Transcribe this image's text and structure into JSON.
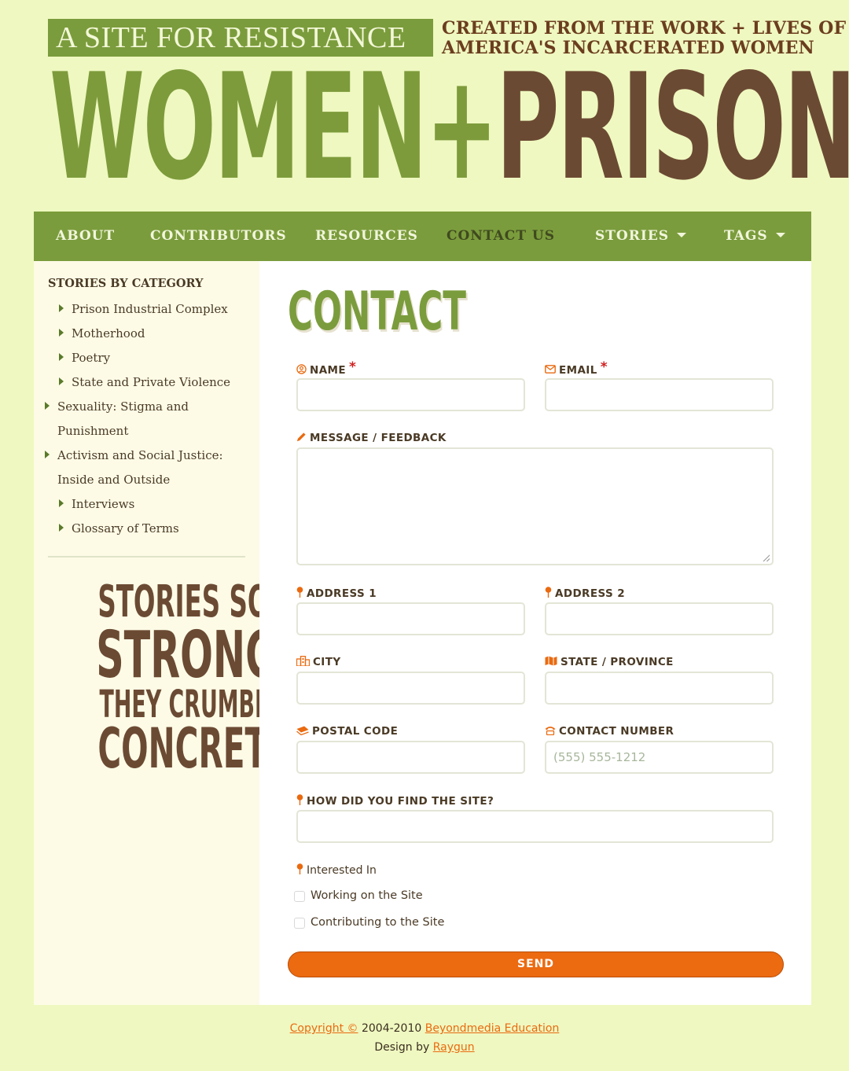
{
  "header": {
    "tagline": "A SITE FOR RESISTANCE",
    "subtitle_line1": "CREATED FROM THE WORK + LIVES OF",
    "subtitle_line2": "AMERICA'S INCARCERATED WOMEN",
    "brand_part1": "WOMEN",
    "brand_plus": "+",
    "brand_part2": "PRISON",
    "colors": {
      "green": "#7b9c3c",
      "brown": "#6b4a33",
      "background": "#eff8c0"
    }
  },
  "nav": {
    "items": [
      {
        "label": "ABOUT"
      },
      {
        "label": "CONTRIBUTORS"
      },
      {
        "label": "RESOURCES"
      },
      {
        "label": "CONTACT US",
        "active": true
      },
      {
        "label": "STORIES",
        "dropdown": true
      },
      {
        "label": "TAGS",
        "dropdown": true
      }
    ]
  },
  "sidebar": {
    "title": "STORIES BY CATEGORY",
    "categories": [
      {
        "label": "Prison Industrial Complex"
      },
      {
        "label": "Motherhood"
      },
      {
        "label": "Poetry"
      },
      {
        "label": "State and Private Violence"
      },
      {
        "label": "Sexuality: Stigma and Punishment"
      },
      {
        "label": "Activism and Social Justice: Inside and Outside"
      },
      {
        "label": "Interviews"
      },
      {
        "label": "Glossary of Terms"
      }
    ],
    "quote": {
      "line1": "STORIES SO",
      "line2": "STRONG",
      "line3": "THEY CRUMBLE",
      "line4": "CONCRETE"
    }
  },
  "main": {
    "title": "CONTACT",
    "form": {
      "name_label": "NAME",
      "name_value": "",
      "email_label": "EMAIL",
      "email_value": "",
      "required_mark": "*",
      "message_label": "MESSAGE / FEEDBACK",
      "message_value": "",
      "address1_label": "ADDRESS 1",
      "address2_label": "ADDRESS 2",
      "city_label": "CITY",
      "state_label": "STATE / PROVINCE",
      "postal_label": "POSTAL CODE",
      "phone_label": "CONTACT NUMBER",
      "phone_placeholder": "(555) 555-1212",
      "found_label": "HOW DID YOU FIND THE SITE?",
      "interested_label": "Interested In",
      "options": [
        {
          "label": "Working on the Site",
          "checked": false
        },
        {
          "label": "Contributing to the Site",
          "checked": false
        }
      ],
      "send_label": "SEND"
    },
    "icons": {
      "name": "user-circle-icon",
      "email": "envelope-icon",
      "message": "pencil-icon",
      "address": "map-pin-icon",
      "city": "city-icon",
      "state": "map-icon",
      "postal": "mail-bulk-icon",
      "phone": "phone-icon",
      "accent_color": "#ea6a10"
    }
  },
  "footer": {
    "copyright_link": "Copyright ©",
    "years": "2004-2010",
    "org_link": "Beyondmedia Education",
    "design_by": "Design by",
    "designer_link": "Raygun"
  }
}
